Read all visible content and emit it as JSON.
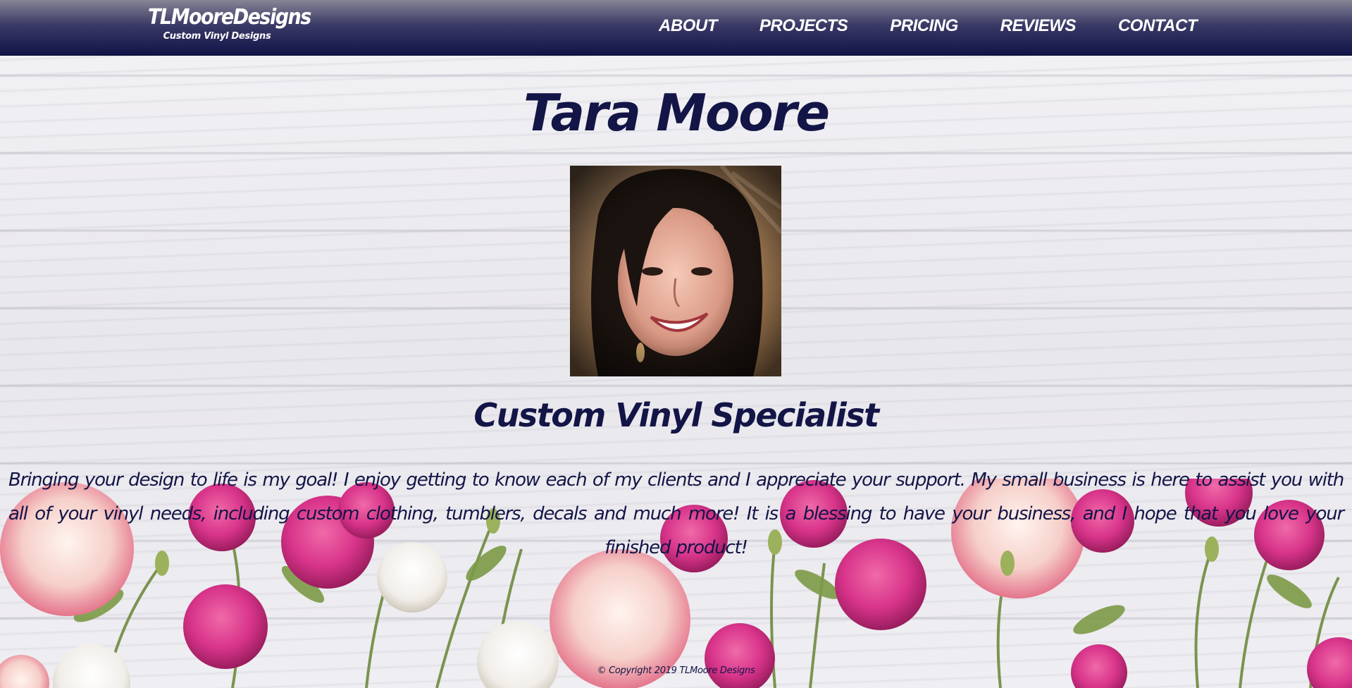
{
  "brand": {
    "name": "TLMooreDesigns",
    "tagline": "Custom Vinyl Designs"
  },
  "nav": {
    "items": [
      {
        "label": "ABOUT"
      },
      {
        "label": "PROJECTS"
      },
      {
        "label": "PRICING"
      },
      {
        "label": "REVIEWS"
      },
      {
        "label": "CONTACT"
      }
    ]
  },
  "main": {
    "title": "Tara Moore",
    "subtitle": "Custom Vinyl Specialist",
    "bio": "Bringing your design to life is my goal! I enjoy getting to know each of my clients and I appreciate your support. My small business is here to assist you with all of your vinyl needs, including custom clothing, tumblers, decals and much more! It is a blessing to have your business, and I hope that you love your finished product!"
  },
  "footer": {
    "copyright": "© Copyright 2019 TLMoore Designs"
  },
  "colors": {
    "navy": "#131547",
    "nav_gradient_top": "#868596",
    "nav_gradient_bottom": "#121448",
    "rose_pink": "#d8348a",
    "rose_light": "#f4c8c8",
    "leaf_green": "#6f8a3e"
  },
  "images": {
    "portrait": "portrait-photo",
    "background": "white-wood-planks",
    "decoration": "pink-roses-border"
  }
}
